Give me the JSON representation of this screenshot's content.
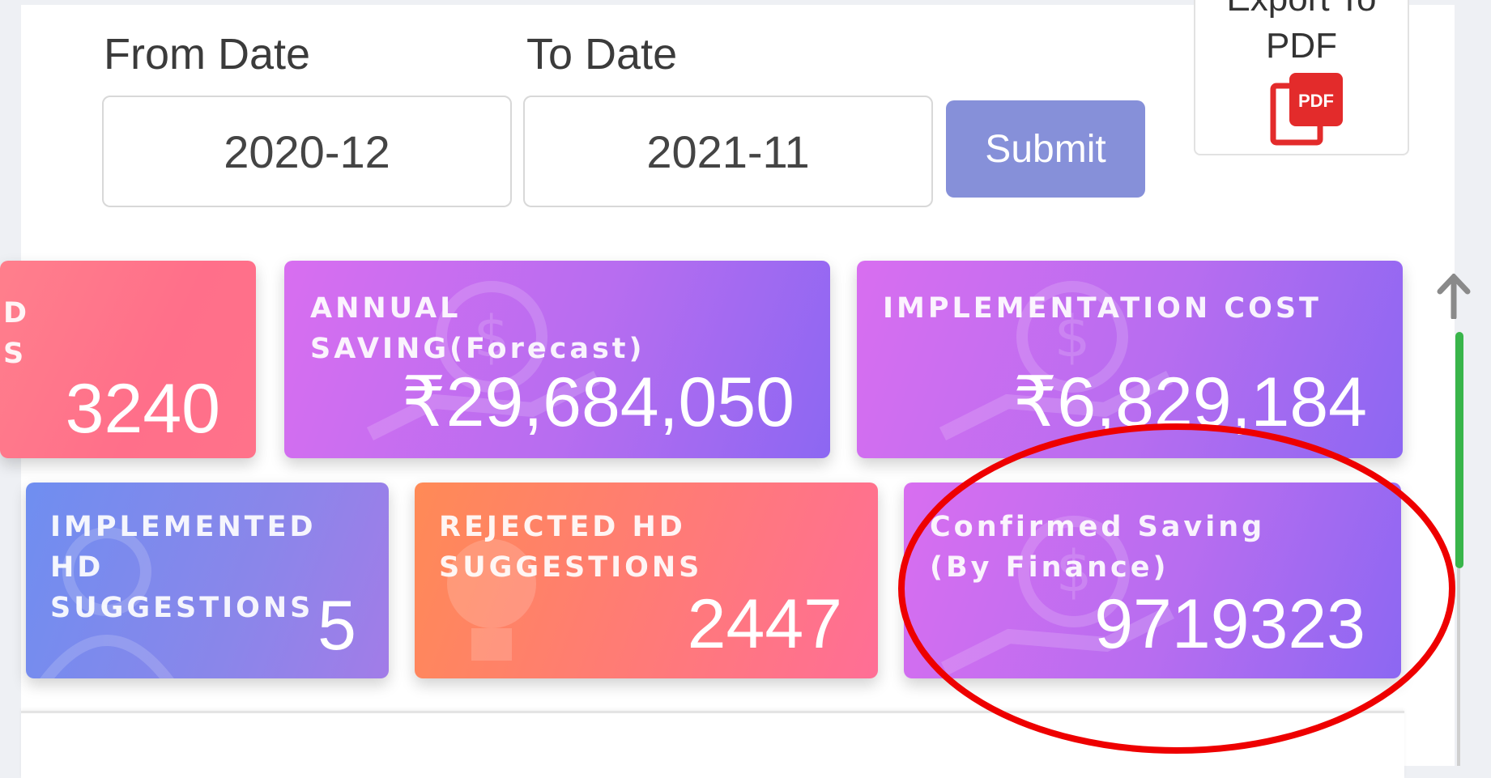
{
  "filters": {
    "from_label": "From Date",
    "from_value": "2020-12",
    "to_label": "To Date",
    "to_value": "2021-11",
    "submit_label": "Submit"
  },
  "export": {
    "label": "Export To\nPDF",
    "icon": "pdf-icon",
    "icon_text": "PDF"
  },
  "cards_row1": [
    {
      "title": "D\nS",
      "value": "3240",
      "color": "#ff758a"
    },
    {
      "title": "ANNUAL\nSAVING(Forecast)",
      "value": "₹29,684,050",
      "color": "#b76df0"
    },
    {
      "title": "IMPLEMENTATION COST",
      "value": "₹6,829,184",
      "color": "#b76df0"
    }
  ],
  "cards_row2": [
    {
      "title": "IMPLEMENTED\nHD\nSUGGESTIONS",
      "value": "5",
      "color": "#8a86ea"
    },
    {
      "title": "REJECTED HD\nSUGGESTIONS",
      "value": "2447",
      "color": "#ff7a78"
    },
    {
      "title": "Confirmed Saving\n(By Finance)",
      "value": "9719323",
      "color": "#b76df0"
    }
  ],
  "colors": {
    "submit": "#8690d9",
    "scrollbar": "#39b54a",
    "highlight": "#ee0000"
  }
}
